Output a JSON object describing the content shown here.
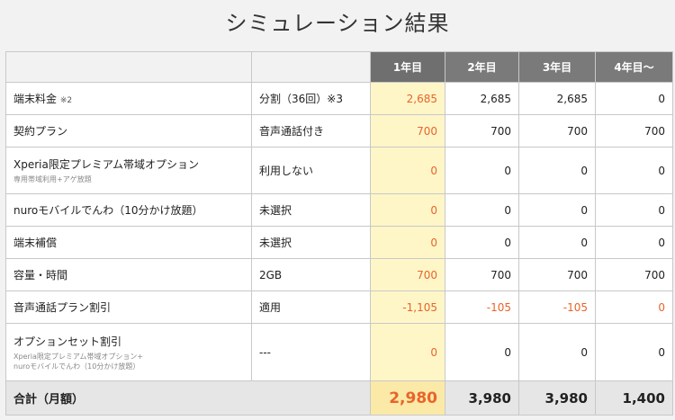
{
  "title": "シミュレーション結果",
  "headers": [
    "1年目",
    "2年目",
    "3年目",
    "4年目〜"
  ],
  "rows": [
    {
      "item": "端末料金",
      "note": "※2",
      "sub": "",
      "option": "分割（36回）※3",
      "y1": "2,685",
      "y2": "2,685",
      "y3": "2,685",
      "y4": "0"
    },
    {
      "item": "契約プラン",
      "note": "",
      "sub": "",
      "option": "音声通話付き",
      "y1": "700",
      "y2": "700",
      "y3": "700",
      "y4": "700"
    },
    {
      "item": "Xperia限定プレミアム帯域オプション",
      "note": "",
      "sub": "専用帯域利用+アゲ放題",
      "option": "利用しない",
      "y1": "0",
      "y2": "0",
      "y3": "0",
      "y4": "0"
    },
    {
      "item": "nuroモバイルでんわ（10分かけ放題）",
      "note": "",
      "sub": "",
      "option": "未選択",
      "y1": "0",
      "y2": "0",
      "y3": "0",
      "y4": "0"
    },
    {
      "item": "端末補償",
      "note": "",
      "sub": "",
      "option": "未選択",
      "y1": "0",
      "y2": "0",
      "y3": "0",
      "y4": "0"
    },
    {
      "item": "容量・時間",
      "note": "",
      "sub": "",
      "option": "2GB",
      "y1": "700",
      "y2": "700",
      "y3": "700",
      "y4": "700"
    },
    {
      "item": "音声通話プラン割引",
      "note": "",
      "sub": "",
      "option": "適用",
      "y1": "-1,105",
      "y2": "-105",
      "y3": "-105",
      "y4": "0"
    },
    {
      "item": "オプションセット割引",
      "note": "",
      "sub": "Xperia限定プレミアム帯域オプション+\nnuroモバイルでんわ（10分かけ放題）",
      "option": "---",
      "y1": "0",
      "y2": "0",
      "y3": "0",
      "y4": "0"
    }
  ],
  "total": {
    "label": "合計（月額）",
    "y1": "2,980",
    "y2": "3,980",
    "y3": "3,980",
    "y4": "1,400"
  },
  "colors": {
    "accent": "#e8642a",
    "year1_bg": "#fff6c8",
    "header_bg": "#7a7a7a"
  }
}
